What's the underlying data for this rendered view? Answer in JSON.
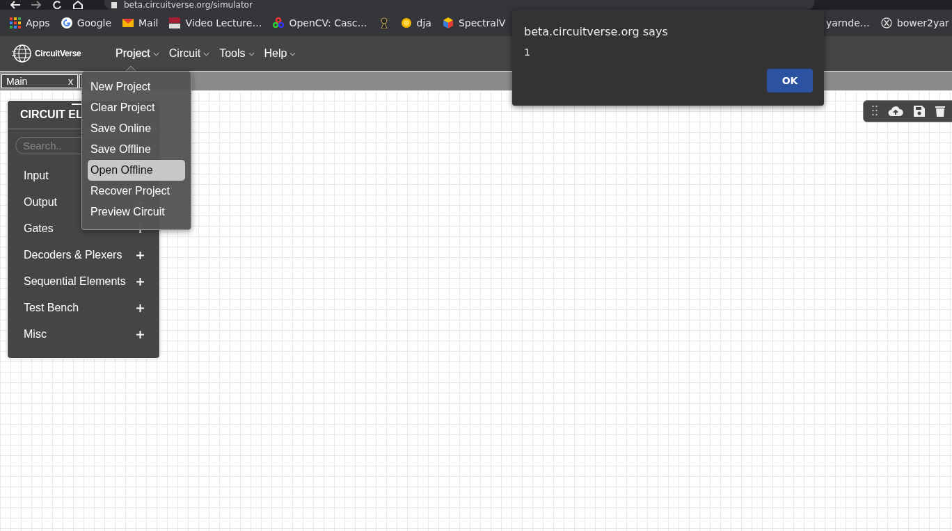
{
  "browser": {
    "url": "beta.circuitverse.org/simulator",
    "bookmarks": [
      {
        "kind": "apps",
        "label": "Apps"
      },
      {
        "kind": "google",
        "label": "Google"
      },
      {
        "kind": "mail",
        "label": "Mail"
      },
      {
        "kind": "mit",
        "label": "Video Lecture…"
      },
      {
        "kind": "opencv",
        "label": "OpenCV: Casc…"
      },
      {
        "kind": "figure"
      },
      {
        "kind": "sun",
        "label": "dja"
      },
      {
        "kind": "cube",
        "label": "SpectralV"
      }
    ],
    "bookmarks_right": [
      {
        "kind": "none",
        "label": "yarnde…"
      },
      {
        "kind": "xcircle",
        "label": "bower2yar"
      }
    ]
  },
  "navbar": {
    "brand": "CircuitVerse",
    "menus": [
      {
        "label": "Project",
        "open": true,
        "items": [
          {
            "label": "New Project",
            "selected": false
          },
          {
            "label": "Clear Project",
            "selected": false
          },
          {
            "label": "Save Online",
            "selected": false
          },
          {
            "label": "Save Offline",
            "selected": false
          },
          {
            "label": "Open Offline",
            "selected": true
          },
          {
            "label": "Recover Project",
            "selected": false
          },
          {
            "label": "Preview Circuit",
            "selected": false
          }
        ]
      },
      {
        "label": "Circuit",
        "open": false
      },
      {
        "label": "Tools",
        "open": false
      },
      {
        "label": "Help",
        "open": false
      }
    ]
  },
  "tabs": [
    {
      "label": "Main",
      "close": "x"
    }
  ],
  "sidebar": {
    "title": "CIRCUIT EL",
    "search": {
      "placeholder": "Search.."
    },
    "categories": [
      {
        "label": "Input",
        "kind": "plain"
      },
      {
        "label": "Output",
        "kind": "expandable"
      },
      {
        "label": "Gates",
        "kind": "expandable"
      },
      {
        "label": "Decoders & Plexers",
        "kind": "expandable"
      },
      {
        "label": "Sequential Elements",
        "kind": "expandable"
      },
      {
        "label": "Test Bench",
        "kind": "expandable"
      },
      {
        "label": "Misc",
        "kind": "expandable"
      }
    ]
  },
  "dialog": {
    "title": "beta.circuitverse.org says",
    "message": "1",
    "buttons": [
      "OK"
    ]
  }
}
